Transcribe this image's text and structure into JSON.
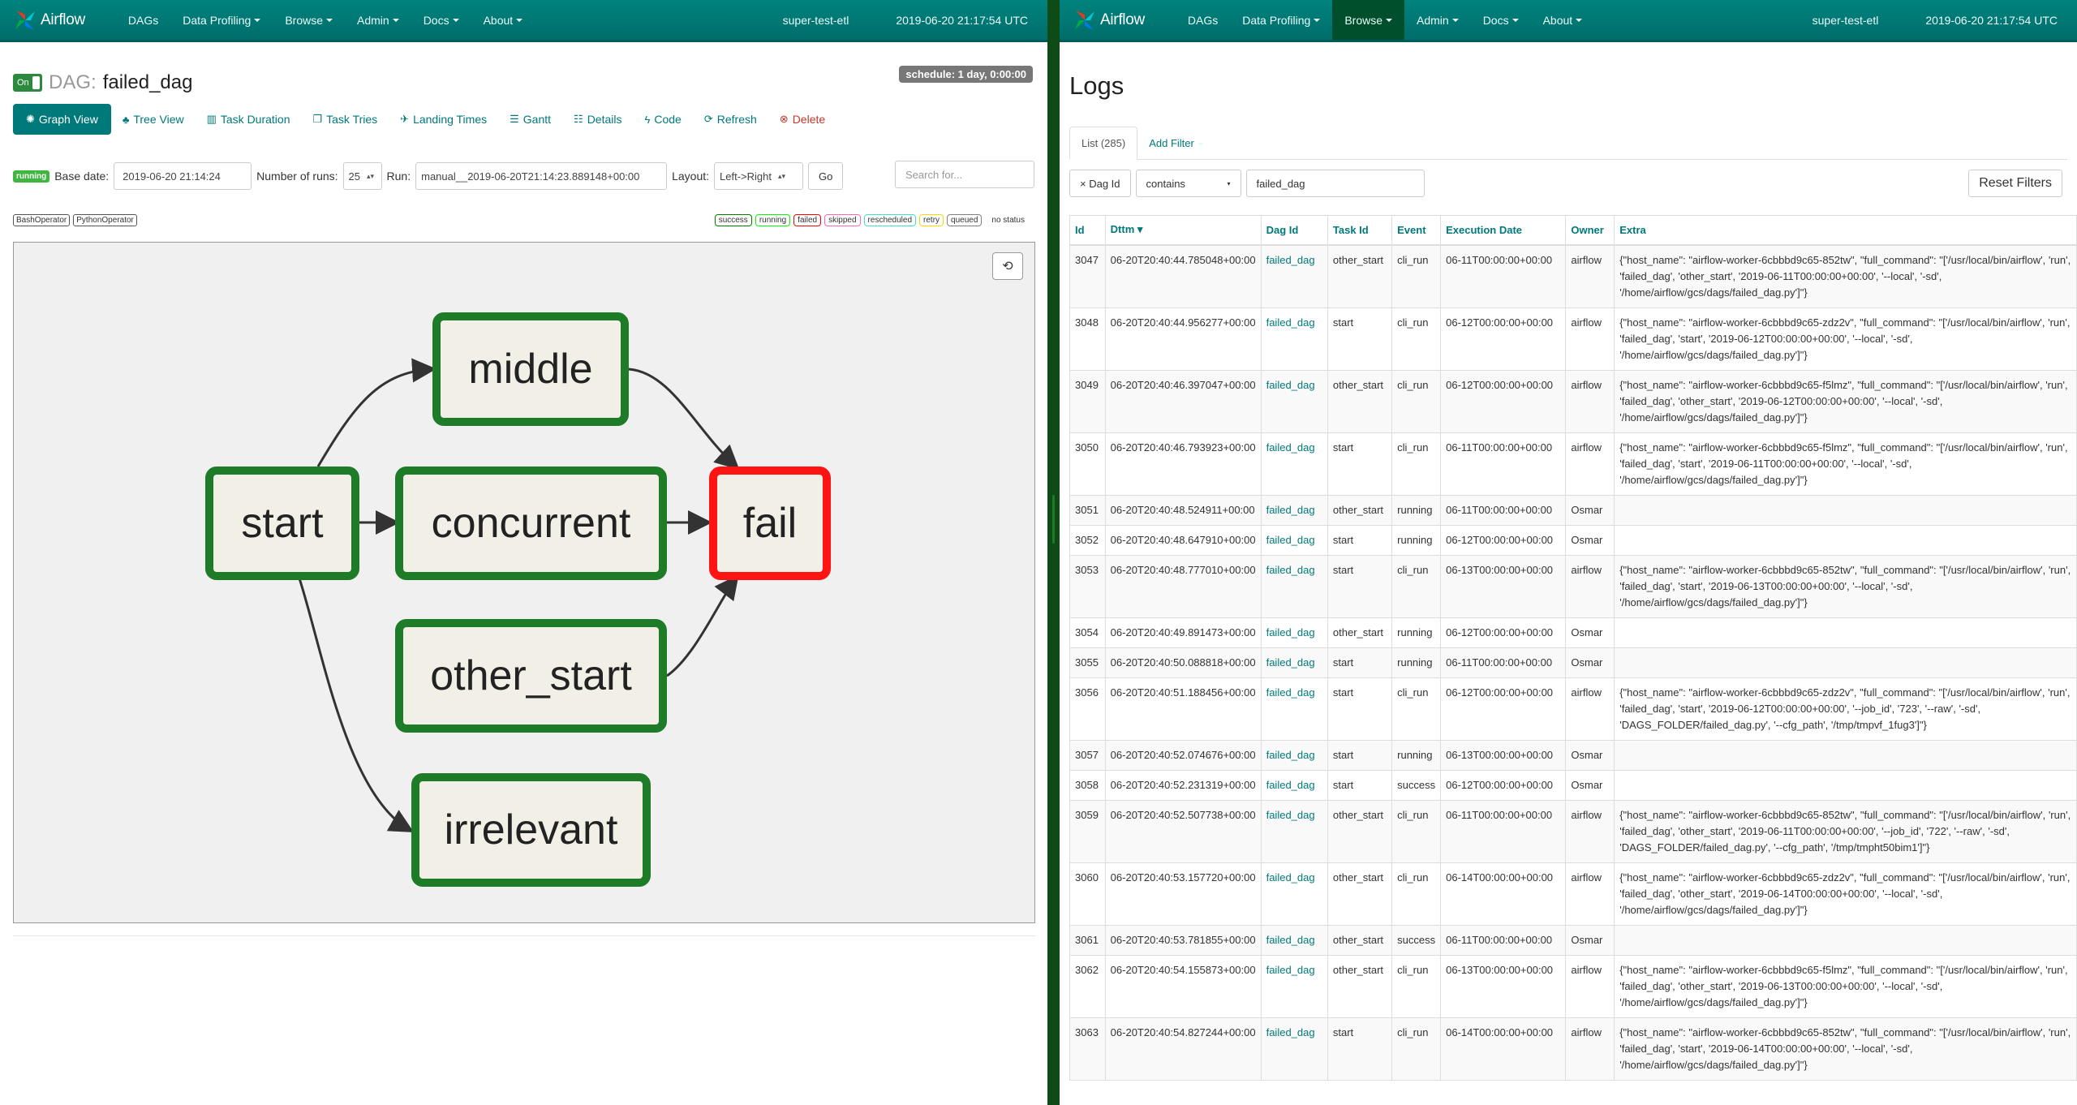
{
  "left": {
    "navbar": {
      "brand": "Airflow",
      "items": [
        "DAGs",
        "Data Profiling",
        "Browse",
        "Admin",
        "Docs",
        "About"
      ],
      "dropdowns": [
        false,
        true,
        true,
        true,
        true,
        true
      ],
      "env": "super-test-etl",
      "time": "2019-06-20 21:17:54 UTC"
    },
    "dag": {
      "toggle": "On",
      "label": "DAG:",
      "id": "failed_dag",
      "schedule": "schedule: 1 day, 0:00:00"
    },
    "tabs": {
      "graph_view": "Graph View",
      "tree_view": "Tree View",
      "task_duration": "Task Duration",
      "task_tries": "Task Tries",
      "landing_times": "Landing Times",
      "gantt": "Gantt",
      "details": "Details",
      "code": "Code",
      "refresh": "Refresh",
      "delete": "Delete"
    },
    "controls": {
      "state": "running",
      "base_date_label": "Base date:",
      "base_date": "2019-06-20 21:14:24",
      "num_runs_label": "Number of runs:",
      "num_runs": "25",
      "run_label": "Run:",
      "run": "manual__2019-06-20T21:14:23.889148+00:00",
      "layout_label": "Layout:",
      "layout": "Left->Right",
      "go": "Go",
      "search_placeholder": "Search for..."
    },
    "operators": [
      "BashOperator",
      "PythonOperator"
    ],
    "statuses": [
      {
        "label": "success",
        "color": "#008000"
      },
      {
        "label": "running",
        "color": "#00ff00"
      },
      {
        "label": "failed",
        "color": "#ff0000"
      },
      {
        "label": "skipped",
        "color": "#ff69b4"
      },
      {
        "label": "rescheduled",
        "color": "#40e0d0"
      },
      {
        "label": "retry",
        "color": "#ffd700"
      },
      {
        "label": "queued",
        "color": "#808080"
      }
    ],
    "no_status": "no status",
    "nodes": {
      "start": "start",
      "middle": "middle",
      "concurrent": "concurrent",
      "fail": "fail",
      "other_start": "other_start",
      "irrelevant": "irrelevant"
    }
  },
  "right": {
    "navbar": {
      "brand": "Airflow",
      "items": [
        "DAGs",
        "Data Profiling",
        "Browse",
        "Admin",
        "Docs",
        "About"
      ],
      "dropdowns": [
        false,
        true,
        true,
        true,
        true,
        true
      ],
      "active": "Browse",
      "env": "super-test-etl",
      "time": "2019-06-20 21:17:54 UTC"
    },
    "title": "Logs",
    "list_tab": "List (285)",
    "add_filter": "Add Filter",
    "filter": {
      "field": "× Dag Id",
      "op": "contains",
      "value": "failed_dag"
    },
    "reset": "Reset Filters",
    "columns": [
      "Id",
      "Dttm",
      "Dag Id",
      "Task Id",
      "Event",
      "Execution Date",
      "Owner",
      "Extra"
    ],
    "rows": [
      {
        "id": "3047",
        "dttm": "06-20T20:40:44.785048+00:00",
        "dag_id": "failed_dag",
        "task_id": "other_start",
        "event": "cli_run",
        "exec": "06-11T00:00:00+00:00",
        "owner": "airflow",
        "extra": "{\"host_name\": \"airflow-worker-6cbbbd9c65-852tw\", \"full_command\": \"['/usr/local/bin/airflow', 'run', 'failed_dag', 'other_start', '2019-06-11T00:00:00+00:00', '--local', '-sd', '/home/airflow/gcs/dags/failed_dag.py']\"}"
      },
      {
        "id": "3048",
        "dttm": "06-20T20:40:44.956277+00:00",
        "dag_id": "failed_dag",
        "task_id": "start",
        "event": "cli_run",
        "exec": "06-12T00:00:00+00:00",
        "owner": "airflow",
        "extra": "{\"host_name\": \"airflow-worker-6cbbbd9c65-zdz2v\", \"full_command\": \"['/usr/local/bin/airflow', 'run', 'failed_dag', 'start', '2019-06-12T00:00:00+00:00', '--local', '-sd', '/home/airflow/gcs/dags/failed_dag.py']\"}"
      },
      {
        "id": "3049",
        "dttm": "06-20T20:40:46.397047+00:00",
        "dag_id": "failed_dag",
        "task_id": "other_start",
        "event": "cli_run",
        "exec": "06-12T00:00:00+00:00",
        "owner": "airflow",
        "extra": "{\"host_name\": \"airflow-worker-6cbbbd9c65-f5lmz\", \"full_command\": \"['/usr/local/bin/airflow', 'run', 'failed_dag', 'other_start', '2019-06-12T00:00:00+00:00', '--local', '-sd', '/home/airflow/gcs/dags/failed_dag.py']\"}"
      },
      {
        "id": "3050",
        "dttm": "06-20T20:40:46.793923+00:00",
        "dag_id": "failed_dag",
        "task_id": "start",
        "event": "cli_run",
        "exec": "06-11T00:00:00+00:00",
        "owner": "airflow",
        "extra": "{\"host_name\": \"airflow-worker-6cbbbd9c65-f5lmz\", \"full_command\": \"['/usr/local/bin/airflow', 'run', 'failed_dag', 'start', '2019-06-11T00:00:00+00:00', '--local', '-sd', '/home/airflow/gcs/dags/failed_dag.py']\"}"
      },
      {
        "id": "3051",
        "dttm": "06-20T20:40:48.524911+00:00",
        "dag_id": "failed_dag",
        "task_id": "other_start",
        "event": "running",
        "exec": "06-11T00:00:00+00:00",
        "owner": "Osmar",
        "extra": ""
      },
      {
        "id": "3052",
        "dttm": "06-20T20:40:48.647910+00:00",
        "dag_id": "failed_dag",
        "task_id": "start",
        "event": "running",
        "exec": "06-12T00:00:00+00:00",
        "owner": "Osmar",
        "extra": ""
      },
      {
        "id": "3053",
        "dttm": "06-20T20:40:48.777010+00:00",
        "dag_id": "failed_dag",
        "task_id": "start",
        "event": "cli_run",
        "exec": "06-13T00:00:00+00:00",
        "owner": "airflow",
        "extra": "{\"host_name\": \"airflow-worker-6cbbbd9c65-852tw\", \"full_command\": \"['/usr/local/bin/airflow', 'run', 'failed_dag', 'start', '2019-06-13T00:00:00+00:00', '--local', '-sd', '/home/airflow/gcs/dags/failed_dag.py']\"}"
      },
      {
        "id": "3054",
        "dttm": "06-20T20:40:49.891473+00:00",
        "dag_id": "failed_dag",
        "task_id": "other_start",
        "event": "running",
        "exec": "06-12T00:00:00+00:00",
        "owner": "Osmar",
        "extra": ""
      },
      {
        "id": "3055",
        "dttm": "06-20T20:40:50.088818+00:00",
        "dag_id": "failed_dag",
        "task_id": "start",
        "event": "running",
        "exec": "06-11T00:00:00+00:00",
        "owner": "Osmar",
        "extra": ""
      },
      {
        "id": "3056",
        "dttm": "06-20T20:40:51.188456+00:00",
        "dag_id": "failed_dag",
        "task_id": "start",
        "event": "cli_run",
        "exec": "06-12T00:00:00+00:00",
        "owner": "airflow",
        "extra": "{\"host_name\": \"airflow-worker-6cbbbd9c65-zdz2v\", \"full_command\": \"['/usr/local/bin/airflow', 'run', 'failed_dag', 'start', '2019-06-12T00:00:00+00:00', '--job_id', '723', '--raw', '-sd', 'DAGS_FOLDER/failed_dag.py', '--cfg_path', '/tmp/tmpvf_1fug3']\"}"
      },
      {
        "id": "3057",
        "dttm": "06-20T20:40:52.074676+00:00",
        "dag_id": "failed_dag",
        "task_id": "start",
        "event": "running",
        "exec": "06-13T00:00:00+00:00",
        "owner": "Osmar",
        "extra": ""
      },
      {
        "id": "3058",
        "dttm": "06-20T20:40:52.231319+00:00",
        "dag_id": "failed_dag",
        "task_id": "start",
        "event": "success",
        "exec": "06-12T00:00:00+00:00",
        "owner": "Osmar",
        "extra": ""
      },
      {
        "id": "3059",
        "dttm": "06-20T20:40:52.507738+00:00",
        "dag_id": "failed_dag",
        "task_id": "other_start",
        "event": "cli_run",
        "exec": "06-11T00:00:00+00:00",
        "owner": "airflow",
        "extra": "{\"host_name\": \"airflow-worker-6cbbbd9c65-852tw\", \"full_command\": \"['/usr/local/bin/airflow', 'run', 'failed_dag', 'other_start', '2019-06-11T00:00:00+00:00', '--job_id', '722', '--raw', '-sd', 'DAGS_FOLDER/failed_dag.py', '--cfg_path', '/tmp/tmpht50bim1']\"}"
      },
      {
        "id": "3060",
        "dttm": "06-20T20:40:53.157720+00:00",
        "dag_id": "failed_dag",
        "task_id": "other_start",
        "event": "cli_run",
        "exec": "06-14T00:00:00+00:00",
        "owner": "airflow",
        "extra": "{\"host_name\": \"airflow-worker-6cbbbd9c65-zdz2v\", \"full_command\": \"['/usr/local/bin/airflow', 'run', 'failed_dag', 'other_start', '2019-06-14T00:00:00+00:00', '--local', '-sd', '/home/airflow/gcs/dags/failed_dag.py']\"}"
      },
      {
        "id": "3061",
        "dttm": "06-20T20:40:53.781855+00:00",
        "dag_id": "failed_dag",
        "task_id": "other_start",
        "event": "success",
        "exec": "06-11T00:00:00+00:00",
        "owner": "Osmar",
        "extra": ""
      },
      {
        "id": "3062",
        "dttm": "06-20T20:40:54.155873+00:00",
        "dag_id": "failed_dag",
        "task_id": "other_start",
        "event": "cli_run",
        "exec": "06-13T00:00:00+00:00",
        "owner": "airflow",
        "extra": "{\"host_name\": \"airflow-worker-6cbbbd9c65-f5lmz\", \"full_command\": \"['/usr/local/bin/airflow', 'run', 'failed_dag', 'other_start', '2019-06-13T00:00:00+00:00', '--local', '-sd', '/home/airflow/gcs/dags/failed_dag.py']\"}"
      },
      {
        "id": "3063",
        "dttm": "06-20T20:40:54.827244+00:00",
        "dag_id": "failed_dag",
        "task_id": "start",
        "event": "cli_run",
        "exec": "06-14T00:00:00+00:00",
        "owner": "airflow",
        "extra": "{\"host_name\": \"airflow-worker-6cbbbd9c65-852tw\", \"full_command\": \"['/usr/local/bin/airflow', 'run', 'failed_dag', 'start', '2019-06-14T00:00:00+00:00', '--local', '-sd', '/home/airflow/gcs/dags/failed_dag.py']\"}"
      }
    ]
  }
}
